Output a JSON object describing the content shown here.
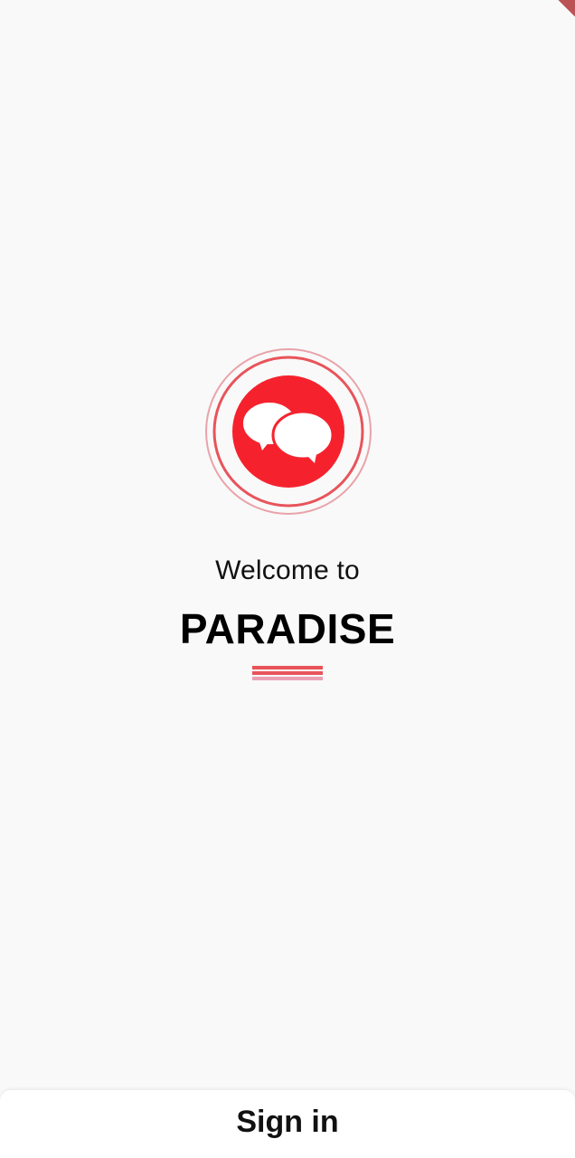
{
  "welcome": {
    "subtitle": "Welcome to",
    "app_name": "PARADISE"
  },
  "logo": {
    "icon": "chat-bubbles-icon",
    "fill_color": "#f5222d",
    "ring_color": "#e8545b",
    "outer_ring_color": "#e9a3aa"
  },
  "divider": {
    "colors": [
      "#e8545b",
      "#e8545b",
      "#eaa0b3"
    ]
  },
  "signin": {
    "label": "Sign in"
  },
  "colors": {
    "background": "#f9f9f9",
    "accent": "#f5222d",
    "debug_banner": "#b0353a"
  }
}
